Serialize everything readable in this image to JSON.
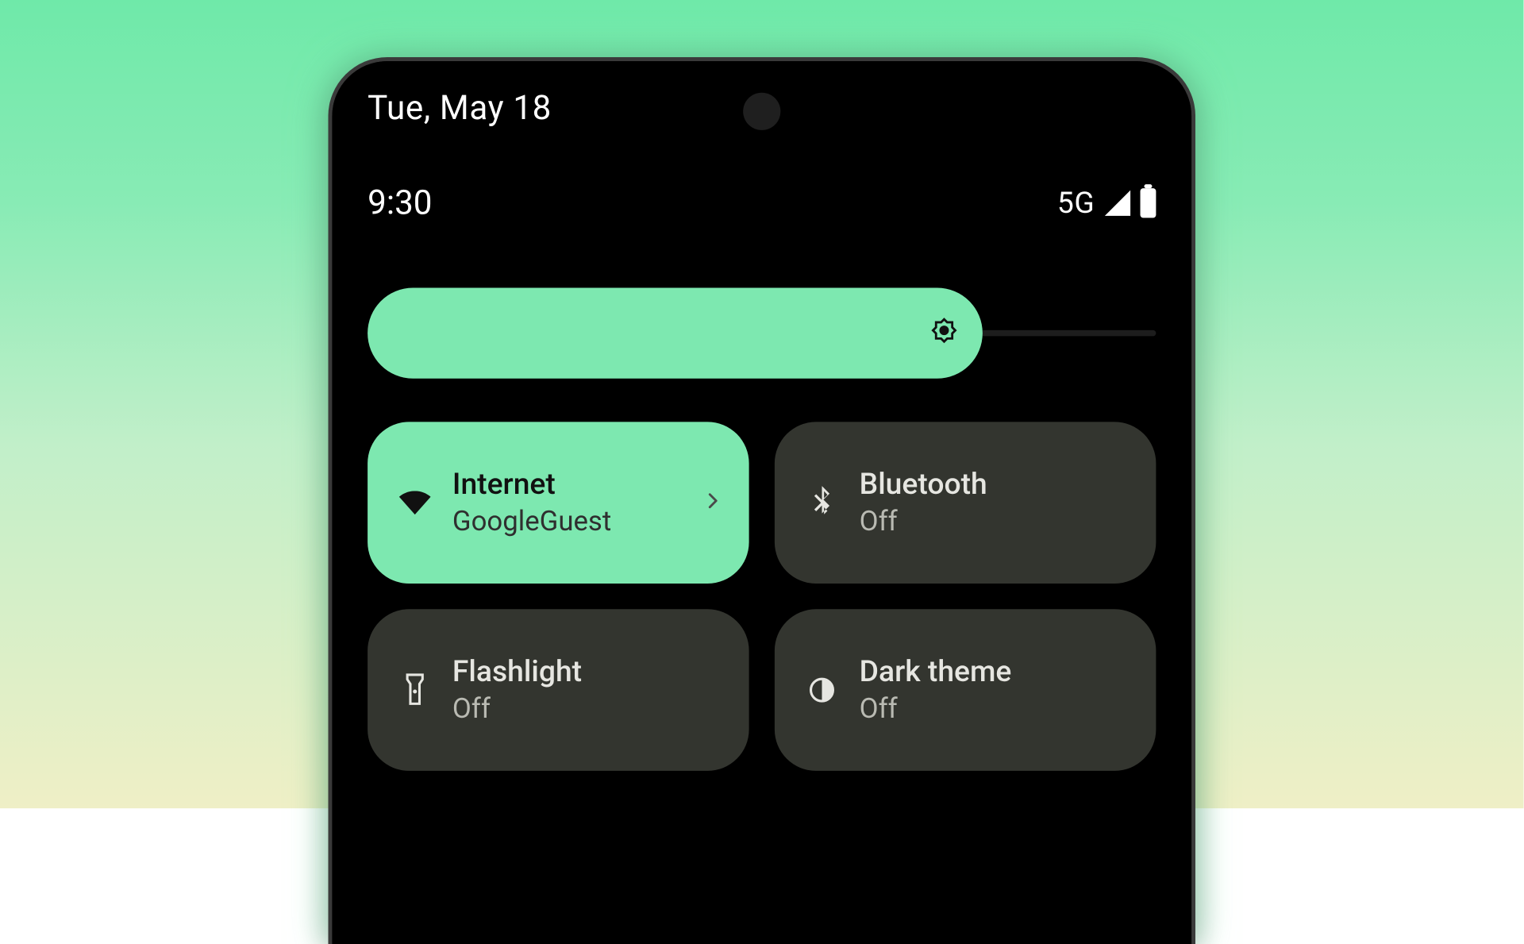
{
  "status": {
    "date": "Tue, May 18",
    "time": "9:30",
    "network_label": "5G"
  },
  "brightness": {
    "percent": 78
  },
  "tiles": {
    "internet": {
      "title": "Internet",
      "sub": "GoogleGuest",
      "state": "on"
    },
    "bluetooth": {
      "title": "Bluetooth",
      "sub": "Off",
      "state": "off"
    },
    "flashlight": {
      "title": "Flashlight",
      "sub": "Off",
      "state": "off"
    },
    "darktheme": {
      "title": "Dark theme",
      "sub": "Off",
      "state": "off"
    }
  },
  "colors": {
    "accent": "#7de8b0",
    "tile_off_bg": "#33352f"
  }
}
